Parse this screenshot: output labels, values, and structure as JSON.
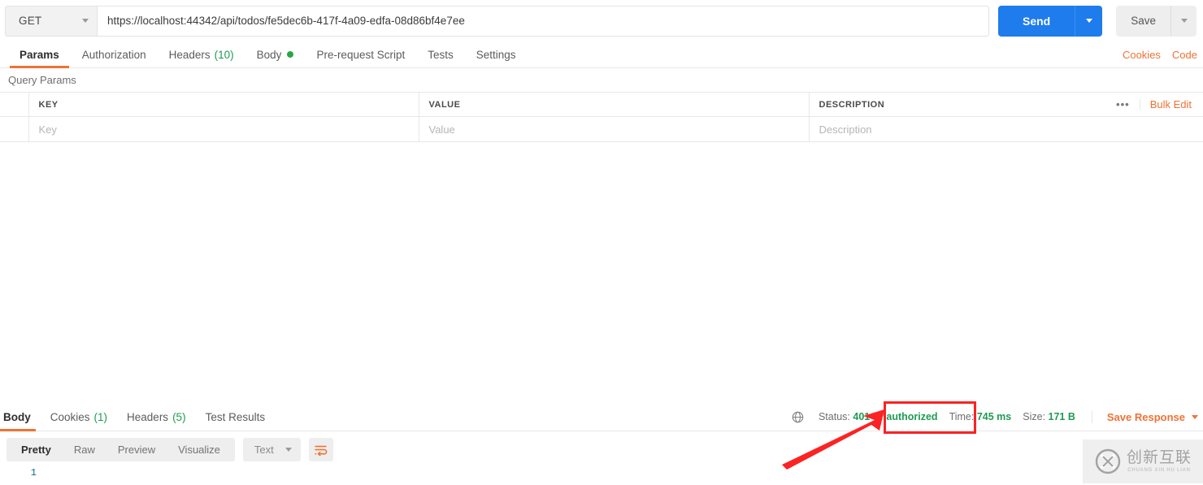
{
  "request": {
    "method": "GET",
    "url": "https://localhost:44342/api/todos/fe5dec6b-417f-4a09-edfa-08d86bf4e7ee",
    "send_label": "Send",
    "save_label": "Save",
    "tabs": [
      {
        "label": "Params",
        "count": "",
        "active": true
      },
      {
        "label": "Authorization",
        "count": "",
        "active": false
      },
      {
        "label": "Headers",
        "count": "(10)",
        "active": false
      },
      {
        "label": "Body",
        "count": "",
        "active": false,
        "dot": true
      },
      {
        "label": "Pre-request Script",
        "count": "",
        "active": false
      },
      {
        "label": "Tests",
        "count": "",
        "active": false
      },
      {
        "label": "Settings",
        "count": "",
        "active": false
      }
    ],
    "links": {
      "cookies": "Cookies",
      "code": "Code"
    }
  },
  "params": {
    "section_title": "Query Params",
    "columns": {
      "key": "KEY",
      "value": "VALUE",
      "description": "DESCRIPTION"
    },
    "placeholder_row": {
      "key": "Key",
      "value": "Value",
      "description": "Description"
    },
    "more_menu": "•••",
    "bulk_edit": "Bulk Edit"
  },
  "response": {
    "tabs": [
      {
        "label": "Body",
        "count": "",
        "active": true
      },
      {
        "label": "Cookies",
        "count": "(1)",
        "active": false
      },
      {
        "label": "Headers",
        "count": "(5)",
        "active": false
      },
      {
        "label": "Test Results",
        "count": "",
        "active": false
      }
    ],
    "status_label": "Status:",
    "status_value": "401 Unauthorized",
    "time_label": "Time:",
    "time_value": "745 ms",
    "size_label": "Size:",
    "size_value": "171 B",
    "save_response": "Save Response",
    "view_modes": [
      {
        "label": "Pretty",
        "active": true
      },
      {
        "label": "Raw",
        "active": false
      },
      {
        "label": "Preview",
        "active": false
      },
      {
        "label": "Visualize",
        "active": false
      }
    ],
    "format": "Text",
    "line_number": "1"
  },
  "colors": {
    "accent_orange": "#ef7235",
    "send_blue": "#1e7ced",
    "status_green": "#1f9b52",
    "annotation_red": "#fb2323"
  },
  "watermark": {
    "cn": "创新互联",
    "en": "CHUANG XIN HU LIAN"
  }
}
